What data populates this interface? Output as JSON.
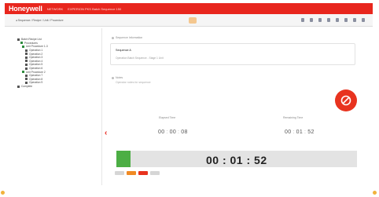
{
  "app": {
    "brand": "Honeywell",
    "title_segments": [
      "NETWORK",
      "EXPERION PKS Batch Sequence 150"
    ]
  },
  "toolbar": {
    "breadcrumb": "◂ Sequence / Recipe / Unit / Procedure",
    "icons": [
      "nav-icon",
      "grid-icon",
      "list-icon",
      "bell-icon",
      "user-icon",
      "help-icon",
      "settings-icon",
      "close-icon"
    ]
  },
  "tree": {
    "items": [
      {
        "label": "Batch Recipe List",
        "green": false
      },
      {
        "label": "Procedures",
        "green": true
      },
      {
        "label": "Unit Procedure 1-3",
        "green": true
      },
      {
        "label": "Operation 1",
        "green": false
      },
      {
        "label": "Operation 2",
        "green": false
      },
      {
        "label": "Operation 3",
        "green": false
      },
      {
        "label": "Operation 4",
        "green": false
      },
      {
        "label": "Operation 5",
        "green": false
      },
      {
        "label": "Operation 6",
        "green": false
      },
      {
        "label": "Unit Procedure 2",
        "green": true
      },
      {
        "label": "Operation 7",
        "green": false
      },
      {
        "label": "Operation 8",
        "green": false
      },
      {
        "label": "Operation 9",
        "green": false
      },
      {
        "label": "Complete",
        "green": false
      }
    ]
  },
  "main": {
    "section_label": "Sequence Information",
    "card_line1": "Sequence A",
    "card_line2": "Operation Batch Sequence - Stage 1 Unit",
    "notes_label": "Notes",
    "notes_value": "Operator notes for sequence",
    "elapsed_label": "Elapsed Time",
    "elapsed": [
      "00",
      "00",
      "08"
    ],
    "remaining_label": "Remaining Time",
    "remaining": [
      "00",
      "01",
      "52"
    ],
    "main_time": "00 : 01 : 52",
    "progress": 0.06
  },
  "chips": [
    {
      "label": "",
      "color": "#d6d6d6"
    },
    {
      "label": "",
      "color": "#f08a24"
    },
    {
      "label": "",
      "color": "#e8331f"
    },
    {
      "label": "",
      "color": "#d6d6d6"
    }
  ],
  "colors": {
    "brand_red": "#e8261d",
    "progress_green": "#4cae44"
  }
}
